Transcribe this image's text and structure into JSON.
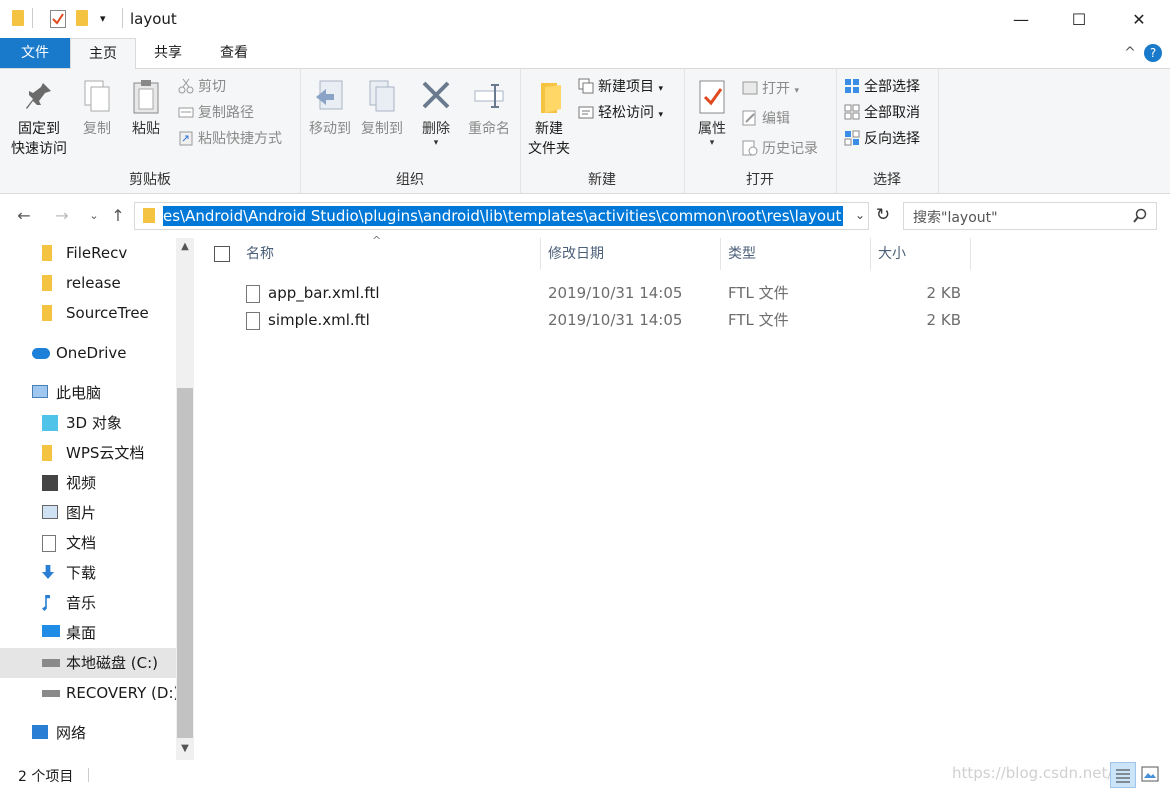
{
  "window": {
    "title": "layout",
    "minimize": "—",
    "maximize": "☐",
    "close": "✕"
  },
  "quick_access_arrow": "▾",
  "tabs": {
    "file": "文件",
    "home": "主页",
    "share": "共享",
    "view": "查看",
    "collapse": "^",
    "help": "?"
  },
  "ribbon": {
    "clipboard": {
      "label": "剪贴板",
      "pin_line1": "固定到",
      "pin_line2": "快速访问",
      "copy": "复制",
      "paste": "粘贴",
      "cut": "剪切",
      "copy_path": "复制路径",
      "paste_shortcut": "粘贴快捷方式"
    },
    "organize": {
      "label": "组织",
      "move_to": "移动到",
      "copy_to": "复制到",
      "delete": "删除",
      "rename": "重命名"
    },
    "new": {
      "label": "新建",
      "new_folder_line1": "新建",
      "new_folder_line2": "文件夹",
      "new_item": "新建项目",
      "easy_access": "轻松访问"
    },
    "open": {
      "label": "打开",
      "properties": "属性",
      "open": "打开",
      "edit": "编辑",
      "history": "历史记录"
    },
    "select": {
      "label": "选择",
      "select_all": "全部选择",
      "select_none": "全部取消",
      "invert": "反向选择"
    }
  },
  "address": {
    "path": "es\\Android\\Android Studio\\plugins\\android\\lib\\templates\\activities\\common\\root\\res\\layout",
    "search_placeholder": "搜索\"layout\""
  },
  "nav_pane": {
    "items": [
      {
        "label": "FileRecv",
        "icon": "folder-icon"
      },
      {
        "label": "release",
        "icon": "folder-icon"
      },
      {
        "label": "SourceTree",
        "icon": "folder-icon"
      },
      {
        "label": "OneDrive",
        "icon": "onedrive-icon"
      },
      {
        "label": "此电脑",
        "icon": "computer-icon"
      },
      {
        "label": "3D 对象",
        "icon": "3d-objects-icon"
      },
      {
        "label": "WPS云文档",
        "icon": "folder-icon"
      },
      {
        "label": "视频",
        "icon": "video-icon"
      },
      {
        "label": "图片",
        "icon": "pictures-icon"
      },
      {
        "label": "文档",
        "icon": "documents-icon"
      },
      {
        "label": "下载",
        "icon": "download-icon"
      },
      {
        "label": "音乐",
        "icon": "music-icon"
      },
      {
        "label": "桌面",
        "icon": "desktop-icon"
      },
      {
        "label": "本地磁盘 (C:)",
        "icon": "local-disk-icon"
      },
      {
        "label": "RECOVERY (D:)",
        "icon": "drive-icon"
      },
      {
        "label": "网络",
        "icon": "network-icon"
      }
    ]
  },
  "file_list": {
    "columns": {
      "name": "名称",
      "modified": "修改日期",
      "type": "类型",
      "size": "大小"
    },
    "rows": [
      {
        "name": "app_bar.xml.ftl",
        "modified": "2019/10/31 14:05",
        "type": "FTL 文件",
        "size": "2 KB"
      },
      {
        "name": "simple.xml.ftl",
        "modified": "2019/10/31 14:05",
        "type": "FTL 文件",
        "size": "2 KB"
      }
    ]
  },
  "status": {
    "count": "2 个项目",
    "watermark": "https://blog.csdn.net/jo"
  },
  "colors": {
    "accent": "#0078d7",
    "file_tab": "#1979ca",
    "folder": "#f5c342"
  }
}
